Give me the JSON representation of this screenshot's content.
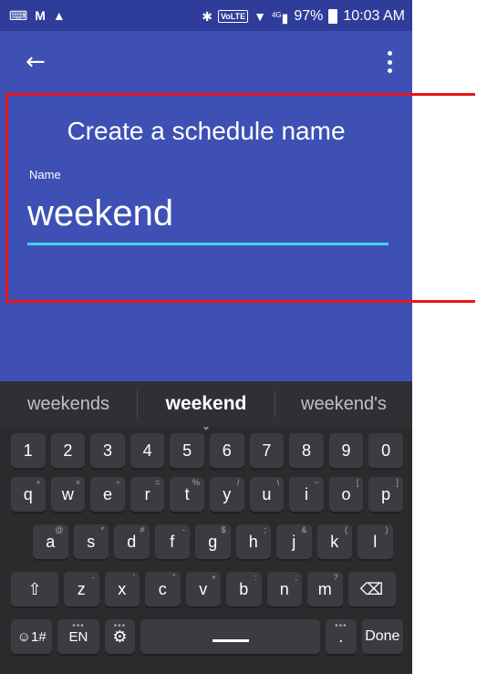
{
  "status_bar": {
    "time": "10:03 AM",
    "battery": "97%",
    "volte": "VoLTE",
    "network": "4G"
  },
  "app_bar": {
    "back_icon": "arrow-left",
    "menu_icon": "more-vert"
  },
  "form": {
    "title": "Create a schedule name",
    "field_label": "Name",
    "field_value": "weekend"
  },
  "keyboard": {
    "suggestions": [
      "weekends",
      "weekend",
      "weekend's"
    ],
    "numbers": [
      "1",
      "2",
      "3",
      "4",
      "5",
      "6",
      "7",
      "8",
      "9",
      "0"
    ],
    "row_q": [
      {
        "key": "q",
        "sub": "+"
      },
      {
        "key": "w",
        "sub": "×"
      },
      {
        "key": "e",
        "sub": "÷"
      },
      {
        "key": "r",
        "sub": "="
      },
      {
        "key": "t",
        "sub": "%"
      },
      {
        "key": "y",
        "sub": "/"
      },
      {
        "key": "u",
        "sub": "\\"
      },
      {
        "key": "i",
        "sub": "~"
      },
      {
        "key": "o",
        "sub": "["
      },
      {
        "key": "p",
        "sub": "]"
      }
    ],
    "row_a": [
      {
        "key": "a",
        "sub": "@"
      },
      {
        "key": "s",
        "sub": "*"
      },
      {
        "key": "d",
        "sub": "#"
      },
      {
        "key": "f",
        "sub": "-"
      },
      {
        "key": "g",
        "sub": "$"
      },
      {
        "key": "h",
        "sub": ";"
      },
      {
        "key": "j",
        "sub": "&"
      },
      {
        "key": "k",
        "sub": "("
      },
      {
        "key": "l",
        "sub": ")"
      }
    ],
    "row_z": [
      {
        "key": "z",
        "sub": "-"
      },
      {
        "key": "x",
        "sub": "'"
      },
      {
        "key": "c",
        "sub": "\""
      },
      {
        "key": "v",
        "sub": "+"
      },
      {
        "key": "b",
        "sub": ":"
      },
      {
        "key": "n",
        "sub": ";"
      },
      {
        "key": "m",
        "sub": "?"
      }
    ],
    "symbols_label": "☺1#",
    "lang_label": "EN",
    "period_label": ".",
    "done_label": "Done"
  },
  "colors": {
    "primary": "#3e50b4",
    "status_bar": "#2f3d9a",
    "accent": "#3fd8e0",
    "highlight": "#e8141b"
  }
}
